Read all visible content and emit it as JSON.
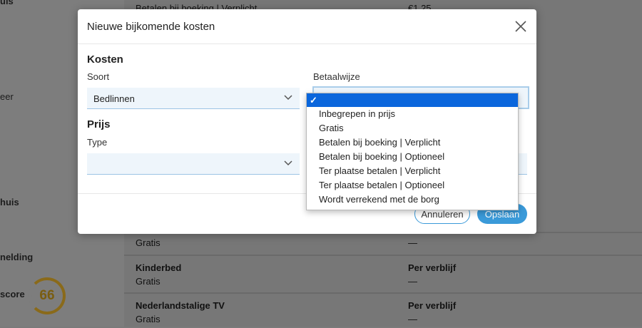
{
  "background": {
    "sidebar_labels": [
      "uis",
      "eer",
      "huis",
      "nelding",
      "score"
    ],
    "score_value": "66",
    "top_row_fragments": {
      "left": "Betalen bij boeking | Verplicht",
      "right": "€1,25"
    },
    "rows": [
      {
        "name": "",
        "price": "Gratis",
        "type": "",
        "value": "—"
      },
      {
        "name": "Kinderbed",
        "price": "Gratis",
        "type": "Per verblijf",
        "value": "—"
      },
      {
        "name": "Nederlandstalige TV",
        "price": "Gratis",
        "type": "Per verblijf",
        "value": "—"
      }
    ]
  },
  "modal": {
    "title": "Nieuwe bijkomende kosten",
    "section_costs": "Kosten",
    "soort_label": "Soort",
    "soort_value": "Bedlinnen",
    "betaalwijze_label": "Betaalwijze",
    "betaalwijze_value": "",
    "section_price": "Prijs",
    "type_label": "Type",
    "type_value": "",
    "cancel_label": "Annuleren",
    "save_label": "Opslaan"
  },
  "dropdown": {
    "selected_marker": "✓",
    "options": [
      "Inbegrepen in prijs",
      "Gratis",
      "Betalen bij boeking | Verplicht",
      "Betalen bij boeking | Optioneel",
      "Ter plaatse betalen | Verplicht",
      "Ter plaatse betalen | Optioneel",
      "Wordt verrekend met de borg"
    ]
  },
  "colors": {
    "accent": "#3a9ad9",
    "selected_option": "#0a66dc",
    "score_ring": "#8a6a1a"
  }
}
